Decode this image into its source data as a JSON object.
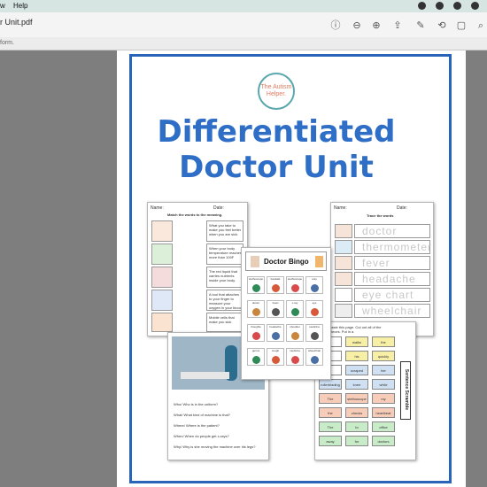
{
  "menubar": {
    "left_items": [
      "w",
      "Help"
    ]
  },
  "window": {
    "title": "r Unit.pdf"
  },
  "infobar": {
    "text": "form."
  },
  "document": {
    "logo_text": "The Autism Helper.",
    "title_line1": "Differentiated",
    "title_line2": "Doctor Unit",
    "matching": {
      "name_label": "Name:",
      "date_label": "Date:",
      "instruction": "Match the words to the meaning.",
      "definitions": [
        "What you take to make you feel better when you are sick.",
        "When your body temperature reaches more than 100F",
        "The red liquid that carries nutrients inside your body.",
        "A tool that attaches to your finger to measure your oxygen in your blood",
        "Mobile cells that make you sick"
      ]
    },
    "trace": {
      "name_label": "Name:",
      "date_label": "Date:",
      "instruction": "Trace the words",
      "words": [
        "doctor",
        "thermometer",
        "fever",
        "headache",
        "eye chart",
        "wheelchair"
      ]
    },
    "bingo": {
      "title": "Doctor Bingo",
      "cells": [
        "stethoscope",
        "bandaid",
        "stethoscope",
        "xray",
        "doctor",
        "heart",
        "x-ray",
        "eye",
        "thoughts",
        "headache",
        "shoulder",
        "medicine",
        "germs",
        "cough",
        "medicine",
        "wheelchair"
      ]
    },
    "photo_questions": [
      "Who/ Who is in the uniform?",
      "What/ What kind of machine is that?",
      "Where/ Where is the patient?",
      "When/ When do people get x-rays?",
      "Why/ Why is she moving the machine over his legs?"
    ],
    "scramble": {
      "instruction": "paste this page. Cut out all of the pieces. Put in a",
      "side_label": "Sentence Scramble",
      "rows": [
        [
          "",
          "walks",
          "the"
        ],
        [
          "",
          "his",
          "quickly"
        ],
        [
          "",
          "scraped",
          "her"
        ],
        [
          "rollerblading",
          "knee",
          "while"
        ],
        [
          "The",
          "stethoscope",
          "my"
        ],
        [
          "the",
          "checks",
          "heartbeat"
        ],
        [
          "The",
          "to",
          "office"
        ],
        [
          "away",
          "for",
          "doctors"
        ]
      ]
    }
  },
  "colors": {
    "accent": "#2f6ec7",
    "frame": "#2a64b8"
  }
}
